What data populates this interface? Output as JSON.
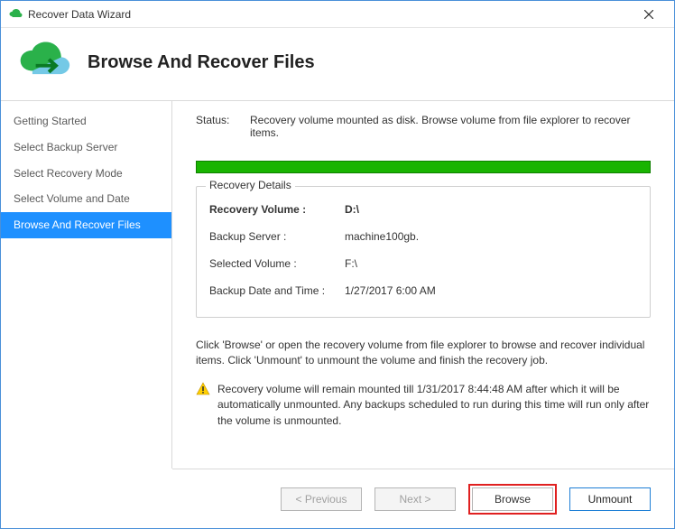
{
  "window": {
    "title": "Recover Data Wizard"
  },
  "header": {
    "title": "Browse And Recover Files"
  },
  "sidebar": {
    "items": [
      {
        "label": "Getting Started",
        "selected": false
      },
      {
        "label": "Select Backup Server",
        "selected": false
      },
      {
        "label": "Select Recovery Mode",
        "selected": false
      },
      {
        "label": "Select Volume and Date",
        "selected": false
      },
      {
        "label": "Browse And Recover Files",
        "selected": true
      }
    ]
  },
  "main": {
    "status_label": "Status:",
    "status_text": "Recovery volume mounted as disk. Browse volume from file explorer to recover items.",
    "progress_percent": 100,
    "details": {
      "legend": "Recovery Details",
      "rows": [
        {
          "key": "Recovery Volume :",
          "value": "D:\\"
        },
        {
          "key": "Backup Server :",
          "value": "machine100gb."
        },
        {
          "key": "Selected Volume :",
          "value": "F:\\"
        },
        {
          "key": "Backup Date and Time :",
          "value": "1/27/2017 6:00 AM"
        }
      ]
    },
    "instruction": "Click 'Browse' or open the recovery volume from file explorer to browse and recover individual items. Click 'Unmount' to unmount the volume and finish the recovery job.",
    "warning": "Recovery volume will remain mounted till 1/31/2017 8:44:48 AM after which it will be automatically unmounted. Any backups scheduled to run during this time will run only after the volume is unmounted."
  },
  "footer": {
    "previous": "< Previous",
    "next": "Next >",
    "browse": "Browse",
    "unmount": "Unmount"
  },
  "colors": {
    "accent": "#1e90ff",
    "progress": "#19b400",
    "highlight": "#e02020"
  }
}
